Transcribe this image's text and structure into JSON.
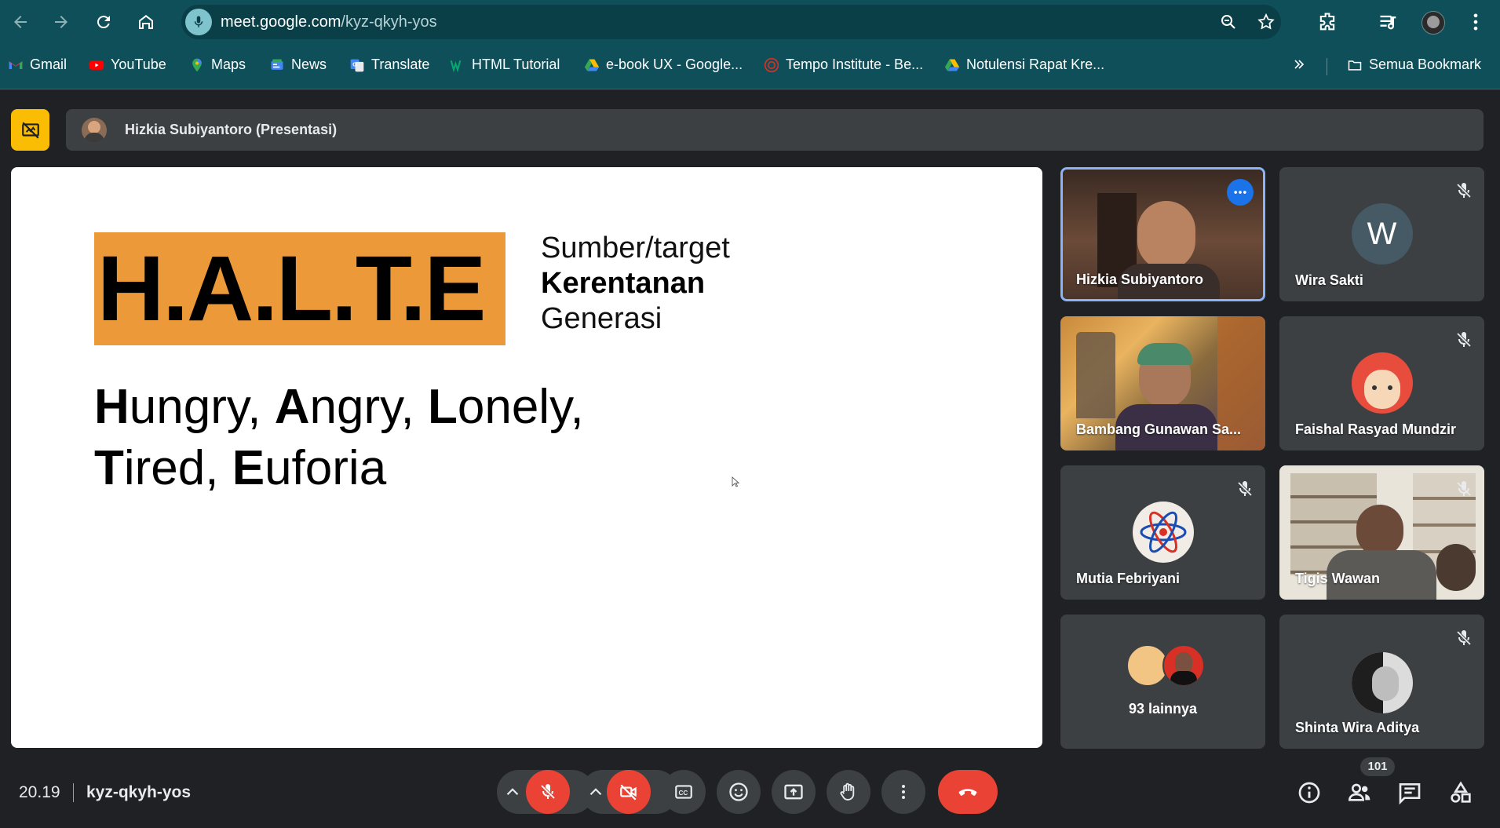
{
  "browser": {
    "url_host": "meet.google.com",
    "url_path": "/kyz-qkyh-yos",
    "bookmarks": [
      {
        "label": "Gmail",
        "icon": "gmail-icon"
      },
      {
        "label": "YouTube",
        "icon": "youtube-icon"
      },
      {
        "label": "Maps",
        "icon": "maps-icon"
      },
      {
        "label": "News",
        "icon": "news-icon"
      },
      {
        "label": "Translate",
        "icon": "translate-icon"
      },
      {
        "label": "HTML Tutorial",
        "icon": "w3schools-icon"
      },
      {
        "label": "e-book UX - Google...",
        "icon": "drive-icon"
      },
      {
        "label": "Tempo Institute - Be...",
        "icon": "tempo-icon"
      },
      {
        "label": "Notulensi Rapat Kre...",
        "icon": "drive-icon"
      }
    ],
    "all_bookmarks_label": "Semua Bookmark"
  },
  "meet": {
    "presenter_label": "Hizkia Subiyantoro (Presentasi)",
    "slide": {
      "logo": "H.A.L.T.E",
      "side_lines": [
        "Sumber/target",
        "Kerentanan",
        "Generasi"
      ],
      "line1": [
        {
          "b": "H",
          "r": "ungry, "
        },
        {
          "b": "A",
          "r": "ngry, "
        },
        {
          "b": "L",
          "r": "onely,"
        }
      ],
      "line2": [
        {
          "b": "T",
          "r": "ired, "
        },
        {
          "b": "E",
          "r": "uforia"
        }
      ]
    },
    "participants": [
      {
        "name": "Hizkia Subiyantoro",
        "type": "video",
        "active": true
      },
      {
        "name": "Wira Sakti",
        "type": "initial",
        "initial": "W",
        "muted": true
      },
      {
        "name": "Bambang Gunawan Sa...",
        "type": "video"
      },
      {
        "name": "Faishal Rasyad Mundzir",
        "type": "avatar",
        "muted": true
      },
      {
        "name": "Mutia Febriyani",
        "type": "avatar",
        "muted": true
      },
      {
        "name": "Tigis Wawan",
        "type": "video",
        "muted": true
      },
      {
        "name": "93 lainnya",
        "type": "others"
      },
      {
        "name": "Shinta Wira Aditya",
        "type": "avatar",
        "muted": true
      }
    ],
    "time": "20.19",
    "meeting_code": "kyz-qkyh-yos",
    "participant_count": "101",
    "colors": {
      "accent": "#8ab4f8",
      "danger": "#ea4335",
      "present": "#fbbc04",
      "halte_bg": "#eb9939"
    }
  }
}
